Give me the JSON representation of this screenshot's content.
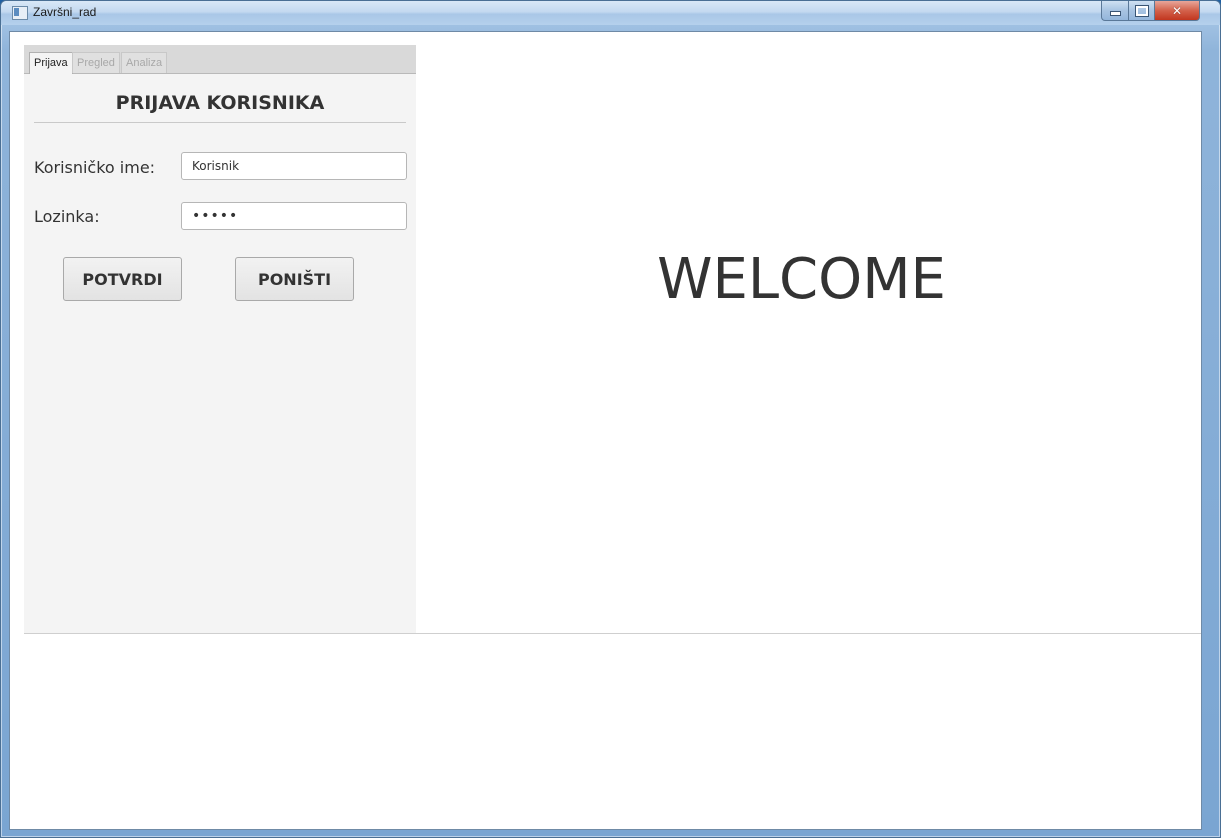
{
  "window": {
    "title": "Završni_rad"
  },
  "tabs": [
    {
      "label": "Prijava",
      "active": true
    },
    {
      "label": "Pregled",
      "active": false
    },
    {
      "label": "Analiza",
      "active": false
    }
  ],
  "login": {
    "heading": "PRIJAVA KORISNIKA",
    "username_label": "Korisničko ime:",
    "username_value": "Korisnik",
    "password_label": "Lozinka:",
    "password_value": "•••••",
    "confirm_label": "POTVRDI",
    "cancel_label": "PONIŠTI"
  },
  "main": {
    "welcome_text": "WELCOME"
  },
  "icons": {
    "app": "app-window-icon",
    "minimize": "minimize-icon",
    "maximize": "maximize-icon",
    "close": "close-icon"
  },
  "colors": {
    "titlebar": "#c3d9f0",
    "close_button": "#c2361f",
    "pane_background": "#f4f4f4",
    "text": "#333333"
  }
}
